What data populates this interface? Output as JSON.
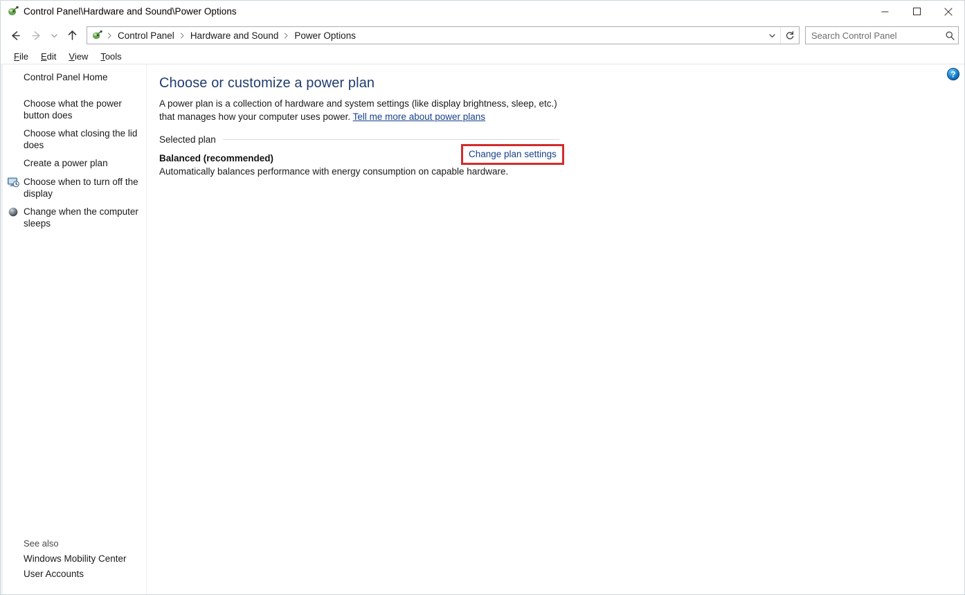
{
  "window": {
    "title": "Control Panel\\Hardware and Sound\\Power Options",
    "app_icon": "control-panel-icon",
    "minimize_label": "Minimize",
    "maximize_label": "Maximize",
    "close_label": "Close"
  },
  "nav": {
    "back_label": "Back",
    "forward_label": "Forward",
    "recent_label": "Recent locations",
    "up_label": "Up one level",
    "dropdown_label": "Previous locations",
    "refresh_label": "Refresh",
    "breadcrumbs": [
      {
        "label": "Control Panel"
      },
      {
        "label": "Hardware and Sound"
      },
      {
        "label": "Power Options"
      }
    ],
    "separator": "›"
  },
  "search": {
    "placeholder": "Search Control Panel",
    "value": "",
    "icon": "search-icon"
  },
  "menubar": {
    "items": [
      {
        "accesskey": "F",
        "rest": "ile"
      },
      {
        "accesskey": "E",
        "rest": "dit"
      },
      {
        "accesskey": "V",
        "rest": "iew"
      },
      {
        "accesskey": "T",
        "rest": "ools"
      }
    ]
  },
  "sidebar": {
    "home": {
      "label": "Control Panel Home"
    },
    "items": [
      {
        "label": "Choose what the power button does",
        "icon": null
      },
      {
        "label": "Choose what closing the lid does",
        "icon": null
      },
      {
        "label": "Create a power plan",
        "icon": null
      },
      {
        "label": "Choose when to turn off the display",
        "icon": "display-clock-icon"
      },
      {
        "label": "Change when the computer sleeps",
        "icon": "sleep-moon-icon"
      }
    ],
    "see_also": {
      "title": "See also",
      "items": [
        {
          "label": "Windows Mobility Center"
        },
        {
          "label": "User Accounts"
        }
      ]
    }
  },
  "main": {
    "help_label": "Help",
    "title": "Choose or customize a power plan",
    "description_part1": "A power plan is a collection of hardware and system settings (like display brightness, sleep, etc.) that manages how your computer uses power.",
    "description_link": "Tell me more about power plans",
    "group_label": "Selected plan",
    "plan_name": "Balanced (recommended)",
    "plan_description": "Automatically balances performance with energy consumption on capable hardware.",
    "change_plan_link": "Change plan settings"
  },
  "colors": {
    "heading": "#1f3c6e",
    "link": "#16418a",
    "highlight_box": "#d42b2b",
    "sidebar_border": "#eef2f4",
    "rule": "#d8dbde"
  }
}
